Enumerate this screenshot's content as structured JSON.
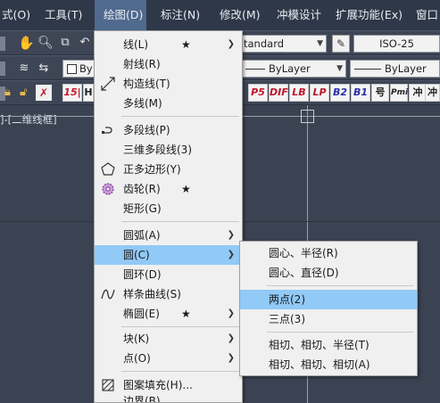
{
  "menubar": {
    "items": [
      {
        "label": "式(O)"
      },
      {
        "label": "工具(T)"
      },
      {
        "label": "绘图(D)"
      },
      {
        "label": "标注(N)"
      },
      {
        "label": "修改(M)"
      },
      {
        "label": "冲模设计"
      },
      {
        "label": "扩展功能(Ex)"
      },
      {
        "label": "窗口"
      }
    ]
  },
  "toolbar1": {
    "text_style": "tandard",
    "dim_style": "ISO-25"
  },
  "toolbar2": {
    "layer_combo": "By",
    "linetype": "ByLayer",
    "lineweight": "ByLayer"
  },
  "toolbar3": {
    "buttons": [
      "15|",
      "H",
      "P5",
      "DIF",
      "LB",
      "LP",
      "B2",
      "B1",
      "号",
      "Pmi",
      "冲",
      "冲"
    ]
  },
  "viewport": {
    "label": "]-[二维线框]"
  },
  "draw_menu": {
    "items": [
      {
        "label": "线(L)",
        "star": "★",
        "submenu": true
      },
      {
        "label": "射线(R)"
      },
      {
        "label": "构造线(T)"
      },
      {
        "label": "多线(M)"
      },
      {
        "label": "多段线(P)"
      },
      {
        "label": "三维多段线(3)"
      },
      {
        "label": "正多边形(Y)"
      },
      {
        "label": "齿轮(R)",
        "star": "★"
      },
      {
        "label": "矩形(G)"
      },
      {
        "label": "圆弧(A)",
        "submenu": true
      },
      {
        "label": "圆(C)",
        "submenu": true,
        "highlighted": true
      },
      {
        "label": "圆环(D)"
      },
      {
        "label": "样条曲线(S)"
      },
      {
        "label": "椭圆(E)",
        "star": "★",
        "submenu": true
      },
      {
        "label": "块(K)",
        "submenu": true
      },
      {
        "label": "点(O)",
        "submenu": true
      },
      {
        "label": "图案填充(H)..."
      },
      {
        "label": "边界(B)..."
      }
    ]
  },
  "circle_submenu": {
    "items": [
      {
        "label": "圆心、半径(R)"
      },
      {
        "label": "圆心、直径(D)"
      },
      {
        "label": "两点(2)",
        "highlighted": true
      },
      {
        "label": "三点(3)"
      },
      {
        "label": "相切、相切、半径(T)"
      },
      {
        "label": "相切、相切、相切(A)"
      }
    ]
  },
  "icons": {
    "pan": "hand-icon",
    "zoom": "magnifier-icon",
    "construction_line": "construction-line-icon",
    "polyline": "polyline-icon",
    "polygon": "pentagon-icon",
    "gear": "gear-icon",
    "spline": "spline-icon",
    "hatch": "hatch-icon"
  },
  "colors": {
    "menubar_bg": "#2f3848",
    "menu_bg": "#f0f0f0",
    "highlight": "#91c9f7",
    "canvas_bg": "#3b4352",
    "red_text": "#c0182a"
  }
}
